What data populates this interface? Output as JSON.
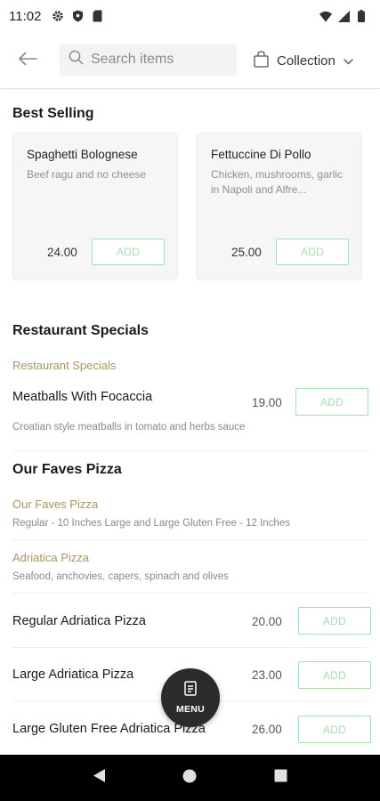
{
  "status_bar": {
    "time": "11:02"
  },
  "header": {
    "search_placeholder": "Search items",
    "collection_label": "Collection"
  },
  "best_selling": {
    "title": "Best Selling",
    "cards": [
      {
        "name": "Spaghetti Bolognese",
        "description": "Beef ragu and no cheese",
        "price": "24.00",
        "add_label": "ADD"
      },
      {
        "name": "Fettuccine Di Pollo",
        "description": "Chicken, mushrooms, garlic in Napoli and Alfre...",
        "price": "25.00",
        "add_label": "ADD"
      }
    ]
  },
  "restaurant_specials": {
    "title": "Restaurant Specials",
    "category_label": "Restaurant Specials",
    "item": {
      "name": "Meatballs With Focaccia",
      "price": "19.00",
      "add_label": "ADD",
      "description": "Croatian style meatballs in tomato and herbs sauce"
    }
  },
  "faves_pizza": {
    "title": "Our Faves Pizza",
    "category_label": "Our Faves Pizza",
    "category_desc": "Regular - 10 Inches  Large and Large Gluten Free - 12 Inches",
    "sub_label": "Adriatica Pizza",
    "sub_desc": "Seafood, anchovies, capers, spinach and olives",
    "items": [
      {
        "name": "Regular Adriatica Pizza",
        "price": "20.00",
        "add_label": "ADD"
      },
      {
        "name": "Large Adriatica Pizza",
        "price": "23.00",
        "add_label": "ADD"
      },
      {
        "name": "Large Gluten Free Adriatica Pizza",
        "price": "26.00",
        "add_label": "ADD"
      }
    ]
  },
  "menu_fab": {
    "label": "MENU"
  },
  "colors": {
    "accent_green": "#a7dcb4",
    "category_gold": "#a79660",
    "fab": "#2b2b2b"
  }
}
